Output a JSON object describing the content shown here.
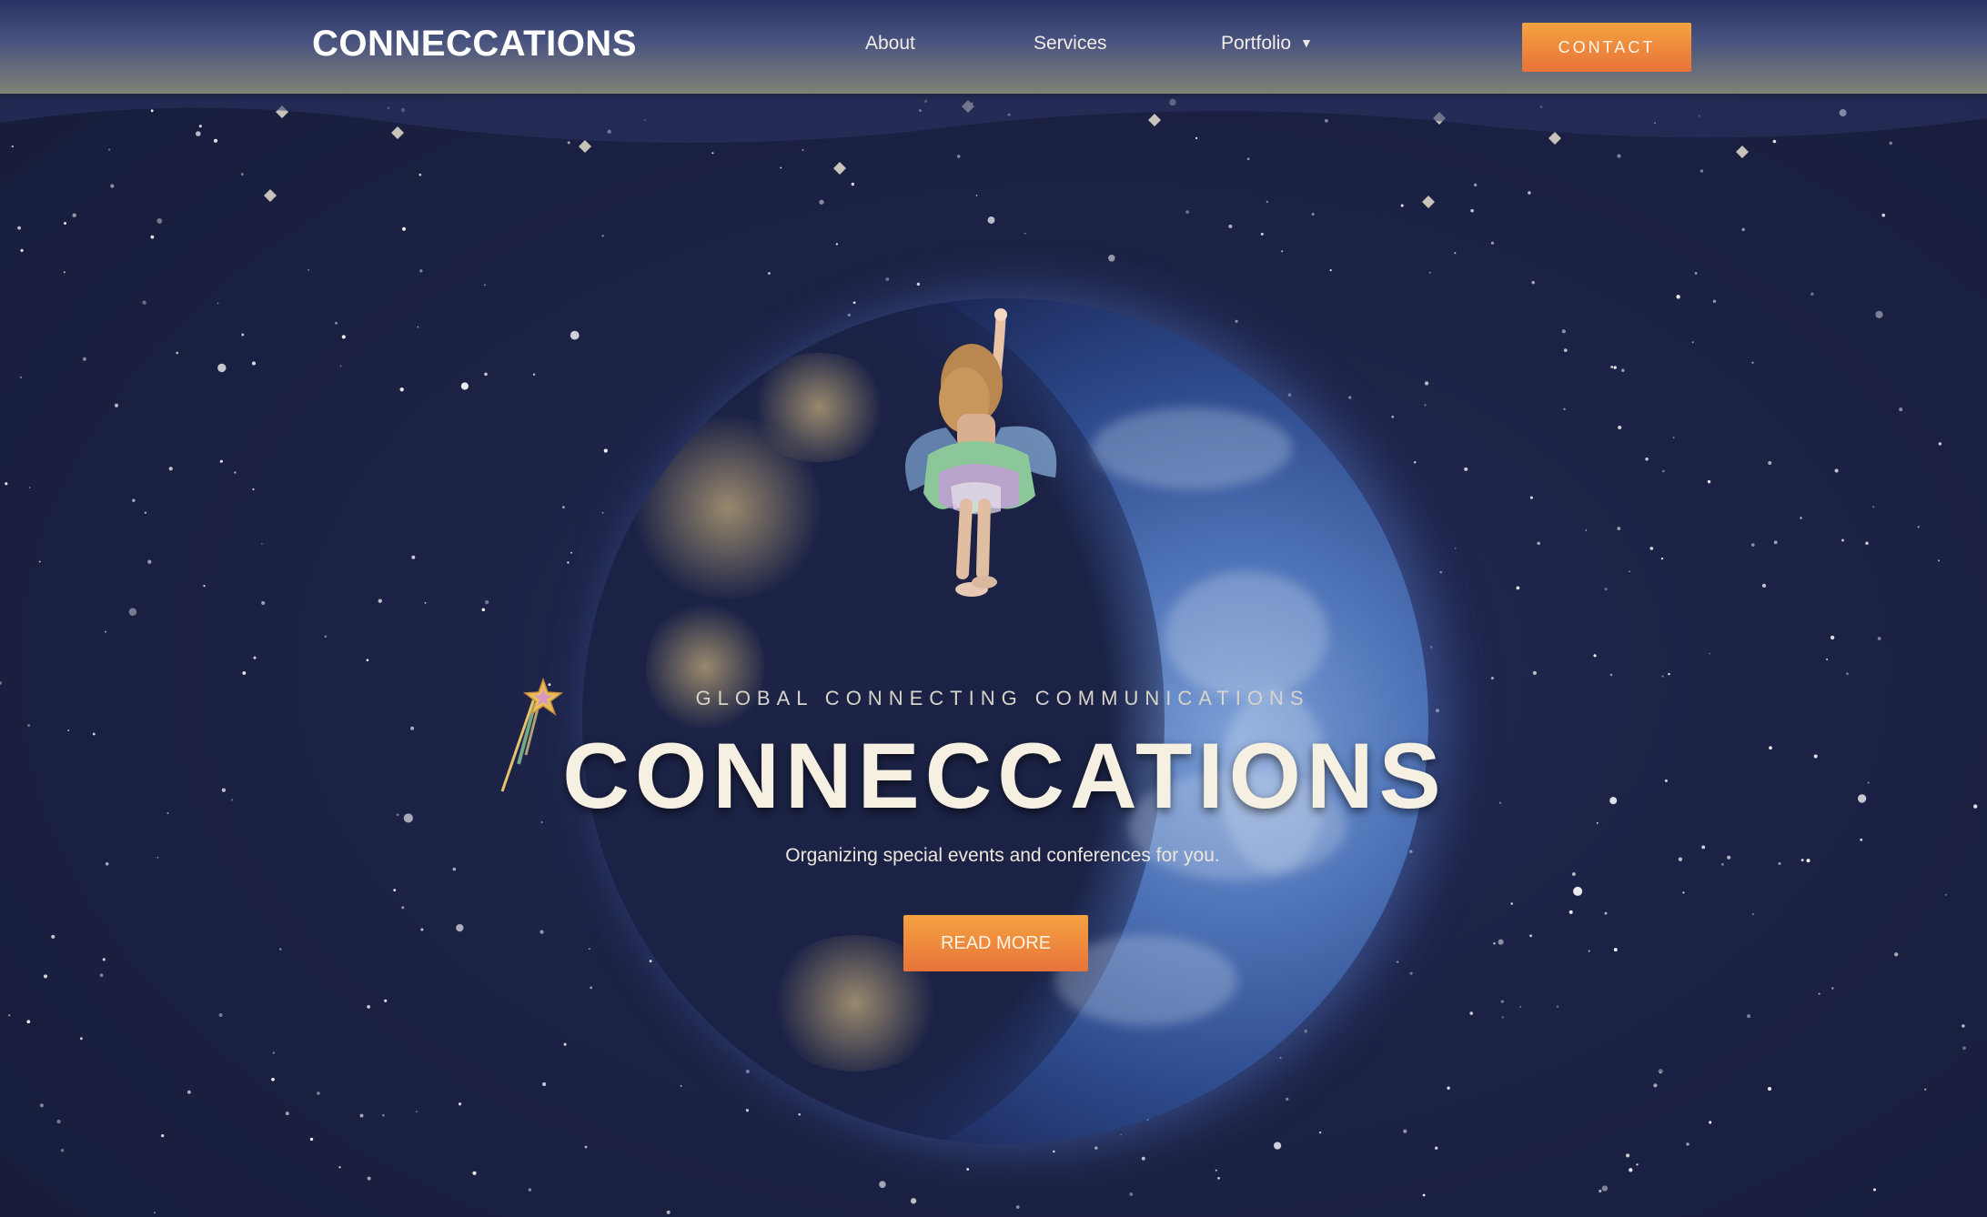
{
  "header": {
    "logo": "CONNECCATIONS",
    "nav": {
      "about": "About",
      "services": "Services",
      "portfolio": "Portfolio"
    },
    "contact_label": "CONTACT"
  },
  "hero": {
    "tagline": "GLOBAL CONNECTING COMMUNICATIONS",
    "title": "CONNECCATIONS",
    "subtitle": "Organizing special events and conferences for you.",
    "cta_label": "READ MORE"
  },
  "icons": {
    "portfolio_dropdown": "chevron-down-icon",
    "wand": "star-wand-icon"
  },
  "colors": {
    "background": "#1c2245",
    "accent_orange": "#f08a3c",
    "title_cream": "#f5f0e1"
  }
}
